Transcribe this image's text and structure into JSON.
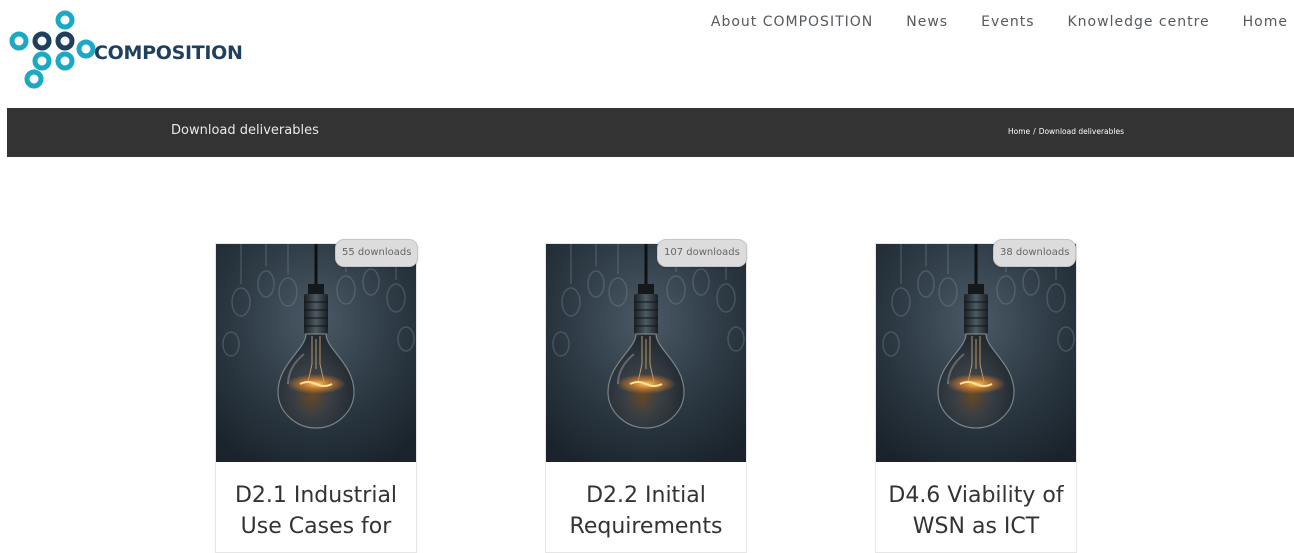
{
  "header": {
    "logo_text": "COMPOSITION",
    "brand_colors": {
      "teal": "#1ba9c6",
      "navy": "#1e3f5e"
    },
    "nav": [
      "About COMPOSITION",
      "News",
      "Events",
      "Knowledge centre",
      "Home"
    ]
  },
  "title_bar": {
    "title": "Download deliverables",
    "breadcrumb": {
      "home": "Home",
      "separator": "/",
      "current": "Download deliverables"
    },
    "background": "#333333"
  },
  "cards": [
    {
      "downloads": "55 downloads",
      "title_line1": "D2.1 Industrial",
      "title_line2": "Use Cases for"
    },
    {
      "downloads": "107 downloads",
      "title_line1": "D2.2 Initial",
      "title_line2": "Requirements"
    },
    {
      "downloads": "38 downloads",
      "title_line1": "D4.6 Viability of",
      "title_line2": "WSN as ICT"
    }
  ]
}
